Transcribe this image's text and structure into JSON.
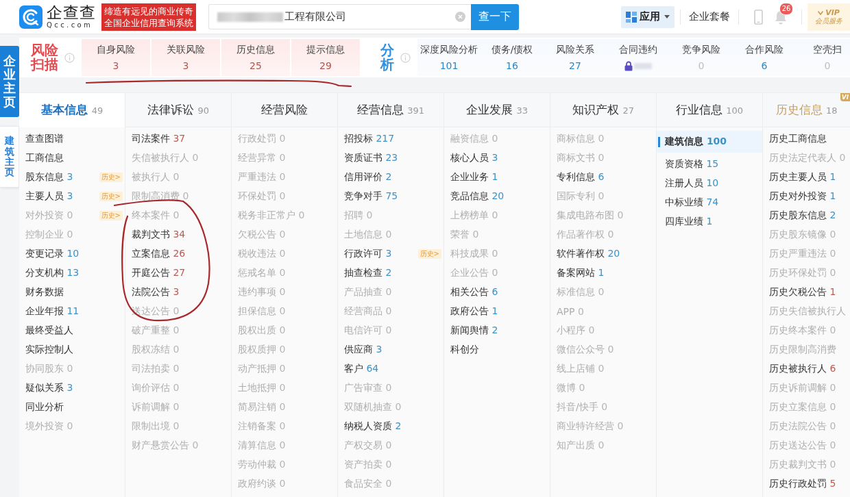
{
  "header": {
    "logo": {
      "name": "企查查",
      "domain": "Qcc.com"
    },
    "slogan": [
      "缔造有远见的商业传奇",
      "全国企业信用查询系统"
    ],
    "search": {
      "value": "工程有限公司",
      "redacted": true
    },
    "search_button": "查一下",
    "apps": "应用",
    "plans": "企业套餐",
    "notifications": "26",
    "vip": {
      "badge": "VIP",
      "label": "会员服务"
    }
  },
  "sidebar": {
    "tabs": [
      {
        "label": "企业主页",
        "selected": true
      },
      {
        "label": "建筑主页",
        "selected": false
      }
    ]
  },
  "risk_scan": {
    "title": "风险扫描",
    "items": [
      {
        "label": "自身风险",
        "count": "3"
      },
      {
        "label": "关联风险",
        "count": "3"
      },
      {
        "label": "历史信息",
        "count": "25"
      },
      {
        "label": "提示信息",
        "count": "29"
      }
    ]
  },
  "analysis": {
    "title": "分析",
    "items": [
      {
        "label": "深度风险分析",
        "count": "101",
        "disabled": false,
        "locked": false
      },
      {
        "label": "债务/债权",
        "count": "16",
        "disabled": false,
        "locked": false
      },
      {
        "label": "风险关系",
        "count": "27",
        "disabled": false,
        "locked": false
      },
      {
        "label": "合同违约",
        "locked": true
      },
      {
        "label": "竞争风险",
        "count": "0",
        "disabled": true,
        "locked": false
      },
      {
        "label": "合作风险",
        "count": "6",
        "disabled": false,
        "locked": false
      },
      {
        "label": "空壳扫",
        "count": "0",
        "disabled": true,
        "locked": false
      }
    ]
  },
  "annotations": [
    {
      "kind": "underline"
    },
    {
      "kind": "circle"
    }
  ],
  "categories": [
    {
      "label": "基本信息",
      "count": "49",
      "selected": true,
      "kind": "list",
      "items": [
        {
          "label": "查查图谱",
          "disabled": false
        },
        {
          "label": "工商信息",
          "disabled": false
        },
        {
          "label": "股东信息",
          "count": "3",
          "color": "#3b92c8",
          "disabled": false,
          "history_tag": "历史>"
        },
        {
          "label": "主要人员",
          "count": "3",
          "color": "#3b92c8",
          "disabled": false,
          "history_tag": "历史>"
        },
        {
          "label": "对外投资",
          "count": "0",
          "disabled": true,
          "history_tag": "历史>"
        },
        {
          "label": "控制企业",
          "count": "0",
          "disabled": true
        },
        {
          "label": "变更记录",
          "count": "10",
          "color": "#3b92c8",
          "disabled": false
        },
        {
          "label": "分支机构",
          "count": "13",
          "color": "#3b92c8",
          "disabled": false
        },
        {
          "label": "财务数据",
          "disabled": false
        },
        {
          "label": "企业年报",
          "count": "11",
          "color": "#3b92c8",
          "disabled": false
        },
        {
          "label": "最终受益人",
          "disabled": false
        },
        {
          "label": "实际控制人",
          "disabled": false
        },
        {
          "label": "协同股东",
          "count": "0",
          "disabled": true
        },
        {
          "label": "疑似关系",
          "count": "3",
          "color": "#3b92c8",
          "disabled": false
        },
        {
          "label": "同业分析",
          "disabled": false
        },
        {
          "label": "境外投资",
          "count": "0",
          "disabled": true
        }
      ]
    },
    {
      "label": "法律诉讼",
      "count": "90",
      "selected": false,
      "kind": "list",
      "items": [
        {
          "label": "司法案件",
          "count": "37",
          "color": "#bf5a50",
          "disabled": false
        },
        {
          "label": "失信被执行人",
          "count": "0",
          "disabled": true
        },
        {
          "label": "被执行人",
          "count": "0",
          "disabled": true
        },
        {
          "label": "限制高消费",
          "count": "0",
          "disabled": true
        },
        {
          "label": "终本案件",
          "count": "0",
          "disabled": true
        },
        {
          "label": "裁判文书",
          "count": "34",
          "color": "#bf5a50",
          "disabled": false
        },
        {
          "label": "立案信息",
          "count": "26",
          "color": "#bf5a50",
          "disabled": false
        },
        {
          "label": "开庭公告",
          "count": "27",
          "color": "#bf5a50",
          "disabled": false
        },
        {
          "label": "法院公告",
          "count": "3",
          "color": "#bf5a50",
          "disabled": false
        },
        {
          "label": "送达公告",
          "count": "0",
          "disabled": true
        },
        {
          "label": "破产重整",
          "count": "0",
          "disabled": true
        },
        {
          "label": "股权冻结",
          "count": "0",
          "disabled": true
        },
        {
          "label": "司法拍卖",
          "count": "0",
          "disabled": true
        },
        {
          "label": "询价评估",
          "count": "0",
          "disabled": true
        },
        {
          "label": "诉前调解",
          "count": "0",
          "disabled": true
        },
        {
          "label": "限制出境",
          "count": "0",
          "disabled": true
        },
        {
          "label": "财产悬赏公告",
          "count": "0",
          "disabled": true
        }
      ]
    },
    {
      "label": "经营风险",
      "selected": false,
      "kind": "list",
      "items": [
        {
          "label": "行政处罚",
          "count": "0",
          "disabled": true
        },
        {
          "label": "经营异常",
          "count": "0",
          "disabled": true
        },
        {
          "label": "严重违法",
          "count": "0",
          "disabled": true
        },
        {
          "label": "环保处罚",
          "count": "0",
          "disabled": true
        },
        {
          "label": "税务非正常户",
          "count": "0",
          "disabled": true
        },
        {
          "label": "欠税公告",
          "count": "0",
          "disabled": true
        },
        {
          "label": "税收违法",
          "count": "0",
          "disabled": true
        },
        {
          "label": "惩戒名单",
          "count": "0",
          "disabled": true
        },
        {
          "label": "违约事项",
          "count": "0",
          "disabled": true
        },
        {
          "label": "担保信息",
          "count": "0",
          "disabled": true
        },
        {
          "label": "股权出质",
          "count": "0",
          "disabled": true
        },
        {
          "label": "股权质押",
          "count": "0",
          "disabled": true
        },
        {
          "label": "动产抵押",
          "count": "0",
          "disabled": true
        },
        {
          "label": "土地抵押",
          "count": "0",
          "disabled": true
        },
        {
          "label": "简易注销",
          "count": "0",
          "disabled": true
        },
        {
          "label": "注销备案",
          "count": "0",
          "disabled": true
        },
        {
          "label": "清算信息",
          "count": "0",
          "disabled": true
        },
        {
          "label": "劳动仲裁",
          "count": "0",
          "disabled": true
        },
        {
          "label": "政府约谈",
          "count": "0",
          "disabled": true
        }
      ]
    },
    {
      "label": "经营信息",
      "count": "391",
      "selected": false,
      "kind": "list",
      "items": [
        {
          "label": "招投标",
          "count": "217",
          "color": "#3b92c8",
          "disabled": false
        },
        {
          "label": "资质证书",
          "count": "23",
          "color": "#3b92c8",
          "disabled": false
        },
        {
          "label": "信用评价",
          "count": "2",
          "color": "#3b92c8",
          "disabled": false
        },
        {
          "label": "竞争对手",
          "count": "75",
          "color": "#3b92c8",
          "disabled": false
        },
        {
          "label": "招聘",
          "count": "0",
          "disabled": true
        },
        {
          "label": "土地信息",
          "count": "0",
          "disabled": true
        },
        {
          "label": "行政许可",
          "count": "3",
          "color": "#3b92c8",
          "disabled": false,
          "history_tag": "历史>"
        },
        {
          "label": "抽查检查",
          "count": "2",
          "color": "#3b92c8",
          "disabled": false
        },
        {
          "label": "产品抽查",
          "count": "0",
          "disabled": true
        },
        {
          "label": "经营商品",
          "count": "0",
          "disabled": true
        },
        {
          "label": "电信许可",
          "count": "0",
          "disabled": true
        },
        {
          "label": "供应商",
          "count": "3",
          "color": "#3b92c8",
          "disabled": false
        },
        {
          "label": "客户",
          "count": "64",
          "color": "#3b92c8",
          "disabled": false
        },
        {
          "label": "广告审查",
          "count": "0",
          "disabled": true
        },
        {
          "label": "双随机抽查",
          "count": "0",
          "disabled": true
        },
        {
          "label": "纳税人资质",
          "count": "2",
          "color": "#3b92c8",
          "disabled": false
        },
        {
          "label": "产权交易",
          "count": "0",
          "disabled": true
        },
        {
          "label": "资产拍卖",
          "count": "0",
          "disabled": true
        },
        {
          "label": "食品安全",
          "count": "0",
          "disabled": true
        }
      ]
    },
    {
      "label": "企业发展",
      "count": "33",
      "selected": false,
      "kind": "list",
      "items": [
        {
          "label": "融资信息",
          "count": "0",
          "disabled": true
        },
        {
          "label": "核心人员",
          "count": "3",
          "color": "#3b92c8",
          "disabled": false
        },
        {
          "label": "企业业务",
          "count": "1",
          "color": "#3b92c8",
          "disabled": false
        },
        {
          "label": "竞品信息",
          "count": "20",
          "color": "#3b92c8",
          "disabled": false
        },
        {
          "label": "上榜榜单",
          "count": "0",
          "disabled": true
        },
        {
          "label": "荣誉",
          "count": "0",
          "disabled": true
        },
        {
          "label": "科技成果",
          "count": "0",
          "disabled": true
        },
        {
          "label": "企业公告",
          "count": "0",
          "disabled": true
        },
        {
          "label": "相关公告",
          "count": "6",
          "color": "#3b92c8",
          "disabled": false
        },
        {
          "label": "政府公告",
          "count": "1",
          "color": "#3b92c8",
          "disabled": false
        },
        {
          "label": "新闻舆情",
          "count": "2",
          "color": "#3b92c8",
          "disabled": false
        },
        {
          "label": "科创分",
          "disabled": false
        }
      ]
    },
    {
      "label": "知识产权",
      "count": "27",
      "selected": false,
      "kind": "list",
      "items": [
        {
          "label": "商标信息",
          "count": "0",
          "disabled": true
        },
        {
          "label": "商标文书",
          "count": "0",
          "disabled": true
        },
        {
          "label": "专利信息",
          "count": "6",
          "color": "#3b92c8",
          "disabled": false
        },
        {
          "label": "国际专利",
          "count": "0",
          "disabled": true
        },
        {
          "label": "集成电路布图",
          "count": "0",
          "disabled": true
        },
        {
          "label": "作品著作权",
          "count": "0",
          "disabled": true
        },
        {
          "label": "软件著作权",
          "count": "20",
          "color": "#3b92c8",
          "disabled": false
        },
        {
          "label": "备案网站",
          "count": "1",
          "color": "#3b92c8",
          "disabled": false
        },
        {
          "label": "标准信息",
          "count": "0",
          "disabled": true
        },
        {
          "label": "APP",
          "count": "0",
          "disabled": true
        },
        {
          "label": "小程序",
          "count": "0",
          "disabled": true
        },
        {
          "label": "微信公众号",
          "count": "0",
          "disabled": true
        },
        {
          "label": "线上店铺",
          "count": "0",
          "disabled": true
        },
        {
          "label": "微博",
          "count": "0",
          "disabled": true
        },
        {
          "label": "抖音/快手",
          "count": "0",
          "disabled": true
        },
        {
          "label": "商业特许经营",
          "count": "0",
          "disabled": true
        },
        {
          "label": "知产出质",
          "count": "0",
          "disabled": true
        }
      ]
    },
    {
      "label": "行业信息",
      "count": "100",
      "selected": false,
      "kind": "subnav",
      "items": [
        {
          "label": "建筑信息",
          "count": "100",
          "color": "#3b92c8",
          "selected": true
        },
        {
          "label": "资质资格",
          "count": "15",
          "color": "#3b92c8",
          "selected": false
        },
        {
          "label": "注册人员",
          "count": "10",
          "color": "#3b92c8",
          "selected": false
        },
        {
          "label": "中标业绩",
          "count": "74",
          "color": "#3b92c8",
          "selected": false
        },
        {
          "label": "四库业绩",
          "count": "1",
          "color": "#3b92c8",
          "selected": false
        }
      ]
    },
    {
      "label": "历史信息",
      "count": "18",
      "selected": false,
      "kind": "list",
      "premium": true,
      "badge": "VI",
      "items": [
        {
          "label": "历史工商信息",
          "disabled": false
        },
        {
          "label": "历史法定代表人",
          "count": "0",
          "disabled": true
        },
        {
          "label": "历史主要人员",
          "count": "1",
          "color": "#3b92c8",
          "disabled": false
        },
        {
          "label": "历史对外投资",
          "count": "1",
          "color": "#3b92c8",
          "disabled": false
        },
        {
          "label": "历史股东信息",
          "count": "2",
          "color": "#3b92c8",
          "disabled": false
        },
        {
          "label": "历史股东镜像",
          "count": "0",
          "disabled": true
        },
        {
          "label": "历史严重违法",
          "count": "0",
          "disabled": true
        },
        {
          "label": "历史环保处罚",
          "count": "0",
          "disabled": true
        },
        {
          "label": "历史欠税公告",
          "count": "1",
          "color": "#bf5a50",
          "disabled": false
        },
        {
          "label": "历史失信被执行人",
          "disabled": true
        },
        {
          "label": "历史终本案件",
          "count": "0",
          "disabled": true
        },
        {
          "label": "历史限制高消费",
          "disabled": true
        },
        {
          "label": "历史被执行人",
          "count": "6",
          "color": "#bf5a50",
          "disabled": false
        },
        {
          "label": "历史诉前调解",
          "count": "0",
          "disabled": true
        },
        {
          "label": "历史立案信息",
          "count": "0",
          "disabled": true
        },
        {
          "label": "历史法院公告",
          "count": "0",
          "disabled": true
        },
        {
          "label": "历史送达公告",
          "count": "0",
          "disabled": true
        },
        {
          "label": "历史裁判文书",
          "count": "0",
          "disabled": true
        },
        {
          "label": "历史行政处罚",
          "count": "5",
          "color": "#bf5a50",
          "disabled": false
        }
      ]
    }
  ]
}
